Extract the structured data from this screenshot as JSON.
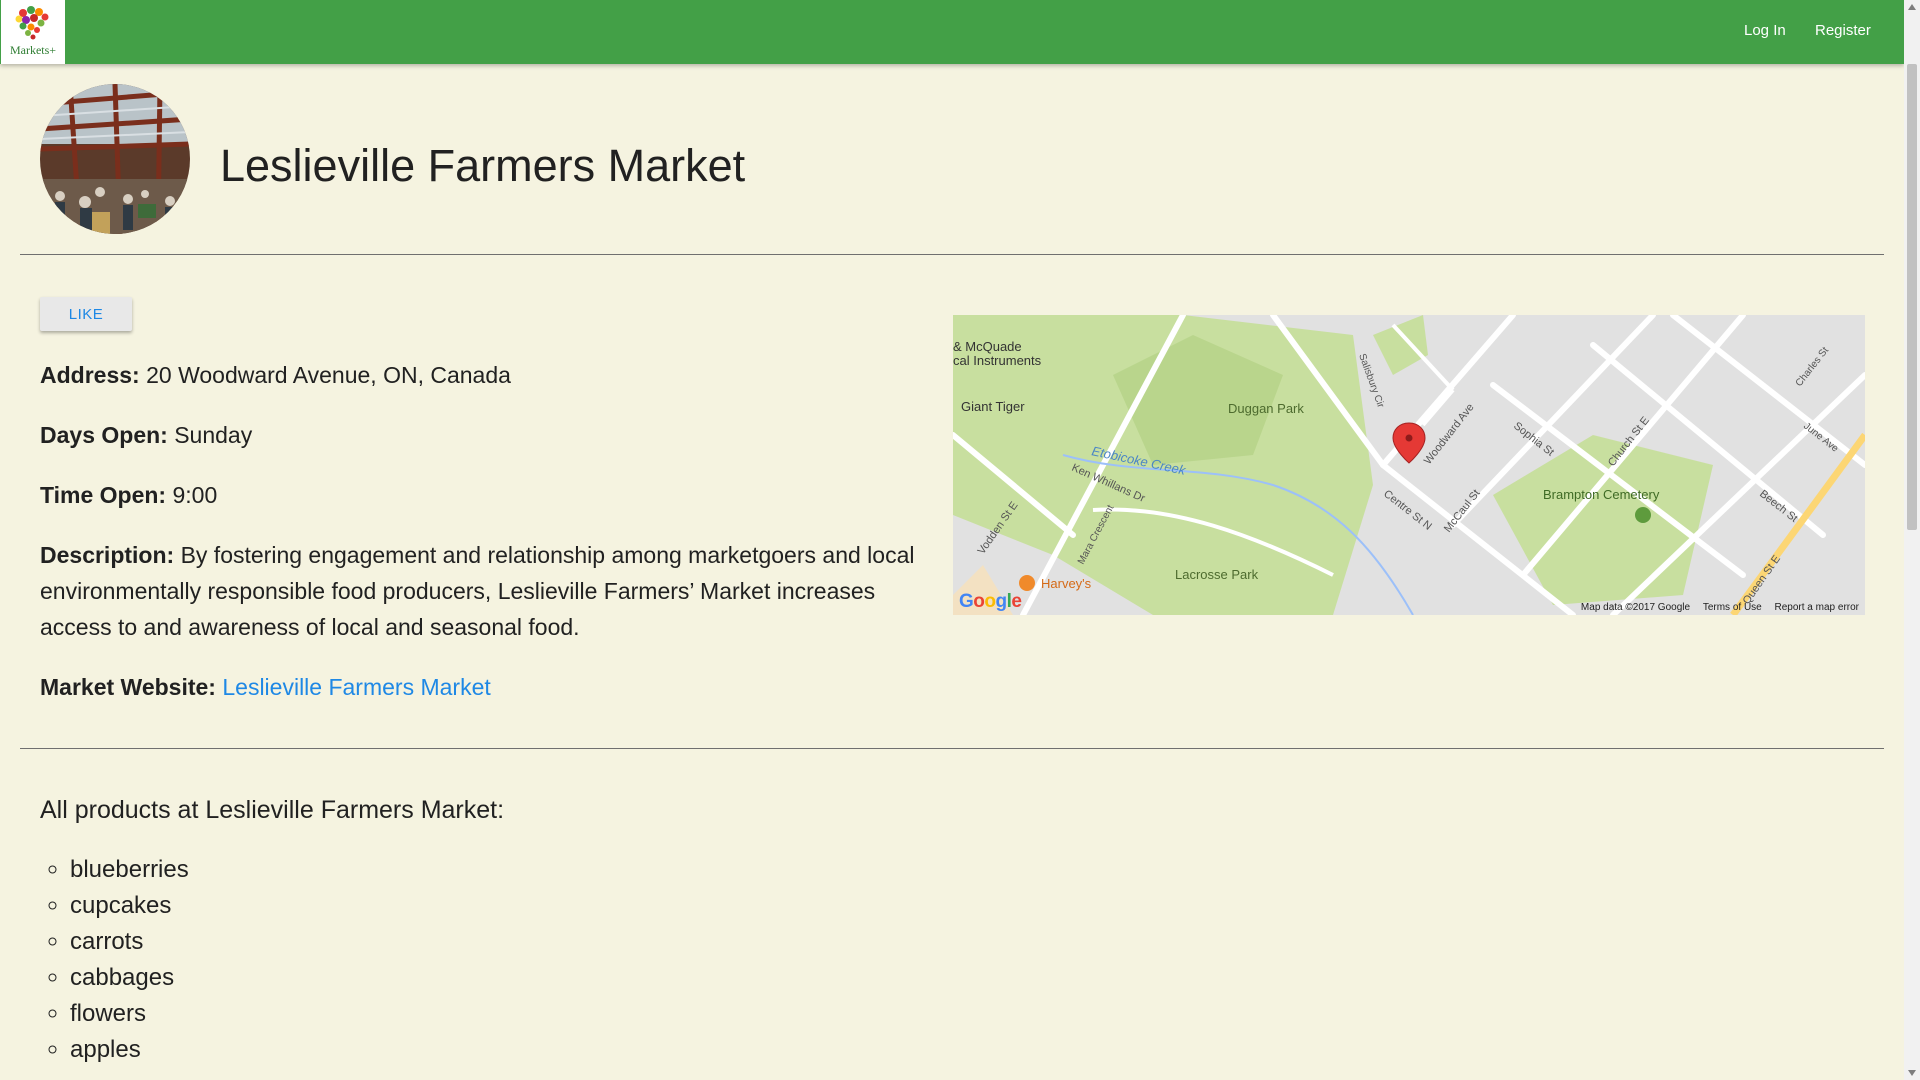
{
  "nav": {
    "logo_text": "Markets+",
    "login_label": "Log In",
    "register_label": "Register"
  },
  "market": {
    "title": "Leslieville Farmers Market",
    "like_label": "LIKE",
    "address_label": "Address:",
    "address": "20 Woodward Avenue, ON, Canada",
    "days_label": "Days Open:",
    "days": "Sunday",
    "time_label": "Time Open:",
    "time": "9:00",
    "description_label": "Description:",
    "description": "By fostering engagement and relationship among marketgoers and local environmentally responsible food producers, Leslieville Farmers’ Market increases access to and awareness of local and seasonal food.",
    "website_label": "Market Website:",
    "website_text": "Leslieville Farmers Market"
  },
  "map": {
    "labels": {
      "mcquade": "& McQuade",
      "instruments": "cal Instruments",
      "giant_tiger": "Giant Tiger",
      "duggan_park": "Duggan Park",
      "etobicoke_creek": "Etobicoke Creek",
      "ken_whillans_dr": "Ken Whillans Dr",
      "vodden_st": "Vodden St E",
      "mara_crescent": "Mara Crescent",
      "harveys": "Harvey's",
      "lacrosse_park": "Lacrosse Park",
      "centre_st": "Centre St N",
      "woodward_ave": "Woodward Ave",
      "mccaul_st": "McCaul St",
      "sophia_st": "Sophia St",
      "church_st": "Church St E",
      "brampton_cemetery": "Brampton Cemetery",
      "beech_st": "Beech St",
      "queen_st": "Queen St E",
      "salisbury_cir": "Salisbury Cir",
      "june_ave": "June Ave",
      "charles_st": "Charles St"
    },
    "google_letters": [
      "G",
      "o",
      "o",
      "g",
      "l",
      "e"
    ],
    "google_colors": [
      "#4285f4",
      "#ea4335",
      "#fbbc05",
      "#4285f4",
      "#34a853",
      "#ea4335"
    ],
    "footer": {
      "map_data": "Map data ©2017 Google",
      "terms": "Terms of Use",
      "report": "Report a map error"
    }
  },
  "products": {
    "heading": "All products at Leslieville Farmers Market:",
    "items": [
      "blueberries",
      "cupcakes",
      "carrots",
      "cabbages",
      "flowers",
      "apples"
    ]
  },
  "colors": {
    "navbar": "#43a047",
    "background": "#f5f3e0",
    "link": "#1e88e5",
    "map_park": "#c8df9f",
    "map_road": "#ffffff",
    "map_block": "#e1e1e1",
    "marker": "#e53935"
  },
  "icons": [
    "heart-basket-logo-icon",
    "map-marker-icon",
    "restaurant-icon",
    "cemetery-icon"
  ]
}
